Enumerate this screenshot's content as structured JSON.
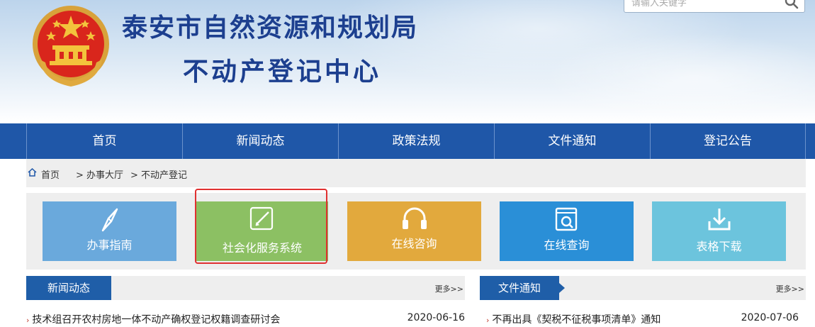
{
  "header": {
    "title_line1": "泰安市自然资源和规划局",
    "title_line2": "不动产登记中心",
    "emblem_icon": "national-emblem-icon",
    "search": {
      "placeholder": "请输入关键字",
      "icon": "search-icon"
    }
  },
  "nav": {
    "items": [
      {
        "label": "首页"
      },
      {
        "label": "新闻动态"
      },
      {
        "label": "政策法规"
      },
      {
        "label": "文件通知"
      },
      {
        "label": "登记公告"
      }
    ]
  },
  "breadcrumb": {
    "home_icon": "home-icon",
    "items": [
      "首页",
      "> 办事大厅",
      "> 不动产登记"
    ]
  },
  "tiles": [
    {
      "label": "办事指南",
      "icon": "compass-icon",
      "color": "#6aa9dc"
    },
    {
      "label": "社会化服务系统",
      "icon": "edit-icon",
      "color": "#8cc063"
    },
    {
      "label": "在线咨询",
      "icon": "headphones-icon",
      "color": "#e2a93d"
    },
    {
      "label": "在线查询",
      "icon": "query-icon",
      "color": "#2a8fd7"
    },
    {
      "label": "表格下载",
      "icon": "download-icon",
      "color": "#6cc4dd"
    }
  ],
  "news": {
    "title": "新闻动态",
    "more": "更多>>",
    "items": [
      {
        "title": "技术组召开农村房地一体不动产确权登记权籍调查研讨会",
        "date": "2020-06-16"
      }
    ]
  },
  "notices": {
    "title": "文件通知",
    "more": "更多>>",
    "items": [
      {
        "title": "不再出具《契税不征税事项清单》通知",
        "date": "2020-07-06"
      }
    ]
  },
  "colors": {
    "nav": "#1f57a8",
    "title": "#1c3f8f",
    "highlight": "#e03030"
  }
}
